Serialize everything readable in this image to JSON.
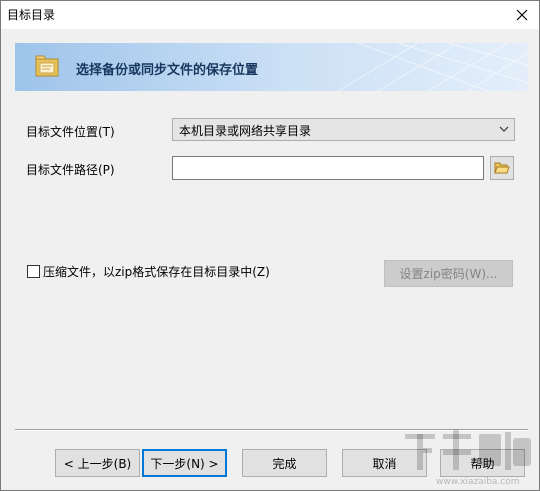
{
  "window": {
    "title": "目标目录"
  },
  "banner": {
    "heading": "选择备份或同步文件的保存位置"
  },
  "form": {
    "location_label": "目标文件位置(T)",
    "location_value": "本机目录或网络共享目录",
    "path_label": "目标文件路径(P)",
    "path_value": ""
  },
  "zip": {
    "checkbox_label": "压缩文件，以zip格式保存在目标目录中(Z)",
    "checked": false,
    "password_button": "设置zip密码(W)..."
  },
  "buttons": {
    "back": "< 上一步(B)",
    "next": "下一步(N) >",
    "finish": "完成",
    "cancel": "取消",
    "help": "帮助"
  },
  "watermark": {
    "text": "下载吧",
    "url_text": "www.xiazaiba.com"
  },
  "colors": {
    "banner_text": "#17375e",
    "default_button_border": "#0078d7"
  }
}
